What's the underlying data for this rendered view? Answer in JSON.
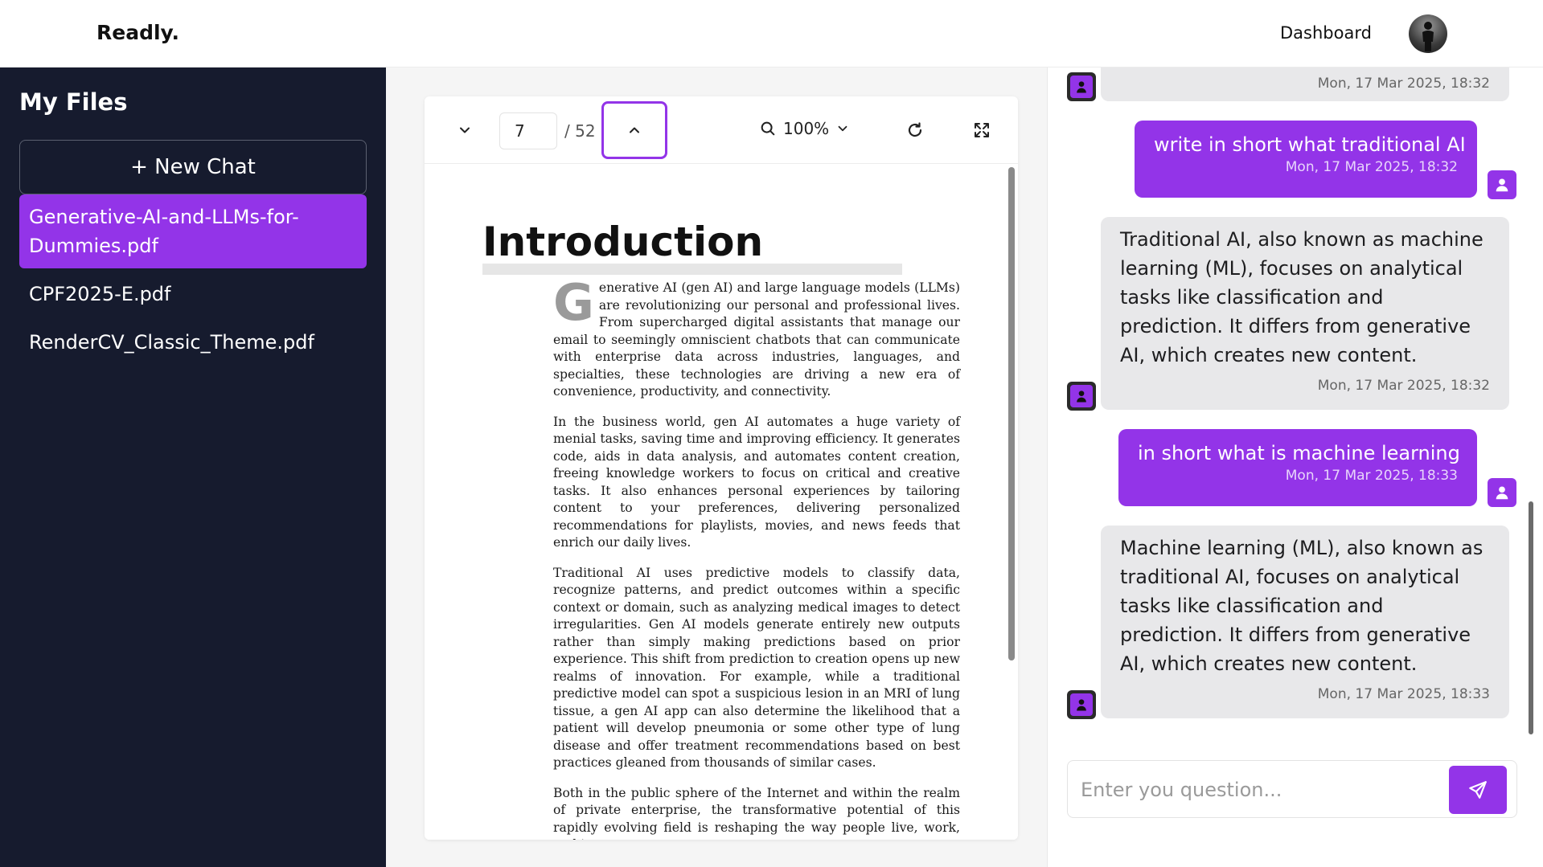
{
  "header": {
    "brand": "Readly.",
    "nav_dashboard": "Dashboard",
    "avatar_icon": "user-photo-avatar"
  },
  "sidebar": {
    "title": "My Files",
    "new_chat_label": "+ New Chat",
    "files": [
      {
        "name": "Generative-AI-and-LLMs-for-Dummies.pdf",
        "active": true
      },
      {
        "name": "CPF2025-E.pdf",
        "active": false
      },
      {
        "name": "RenderCV_Classic_Theme.pdf",
        "active": false
      }
    ]
  },
  "pdf_viewer": {
    "current_page": "7",
    "total_pages": "/ 52",
    "zoom": "100%",
    "icons": [
      "chevron-down-icon",
      "chevron-up-icon",
      "search-icon",
      "refresh-icon",
      "fullscreen-icon"
    ],
    "page": {
      "heading": "Introduction",
      "dropcap": "G",
      "paragraphs": [
        "enerative AI (gen AI) and large language models (LLMs) are revolutionizing our personal and professional lives. From supercharged digital assistants that manage our email to seemingly omniscient chatbots that can communicate with enterprise data across industries, languages, and specialties, these technologies are driving a new era of convenience, productivity, and connectivity.",
        "In the business world, gen AI automates a huge variety of menial tasks, saving time and improving efficiency. It generates code, aids in data analysis, and automates content creation, freeing knowledge workers to focus on critical and creative tasks. It also enhances personal experiences by tailoring content to your preferences, delivering personalized recommendations for playlists, movies, and news feeds that enrich our daily lives.",
        "Traditional AI uses predictive models to classify data, recognize patterns, and predict outcomes within a specific context or domain, such as analyzing medical images to detect irregularities. Gen AI models generate entirely new outputs rather than simply making predictions based on prior experience. This shift from prediction to creation opens up new realms of innovation. For example, while a traditional predictive model can spot a suspicious lesion in an MRI of lung tissue, a gen AI app can also determine the likelihood that a patient will develop pneumonia or some other type of lung disease and offer treatment recommendations based on best practices gleaned from thousands of similar cases.",
        "Both in the public sphere of the Internet and within the realm of private enterprise, the transformative potential of this rapidly evolving field is reshaping the way people live, work, and interact."
      ]
    }
  },
  "chat": {
    "messages": [
      {
        "role": "bot",
        "text": "",
        "time": "Mon, 17 Mar 2025, 18:32"
      },
      {
        "role": "user",
        "text": "write in short what traditional AI",
        "time": "Mon, 17 Mar 2025, 18:32"
      },
      {
        "role": "bot",
        "text": "Traditional AI, also known as machine learning (ML), focuses on analytical tasks like classification and prediction. It differs from generative AI, which creates new content.",
        "time": "Mon, 17 Mar 2025, 18:32"
      },
      {
        "role": "user",
        "text": "in short what is machine learning",
        "time": "Mon, 17 Mar 2025, 18:33"
      },
      {
        "role": "bot",
        "text": "Machine learning (ML), also known as traditional AI, focuses on analytical tasks like classification and prediction. It differs from generative AI, which creates new content.",
        "time": "Mon, 17 Mar 2025, 18:33"
      }
    ],
    "input_placeholder": "Enter you question...",
    "send_icon": "send-icon"
  },
  "colors": {
    "accent": "#9334e8",
    "sidebar_bg": "#161b2e",
    "bot_bubble": "#e8e8ea"
  }
}
